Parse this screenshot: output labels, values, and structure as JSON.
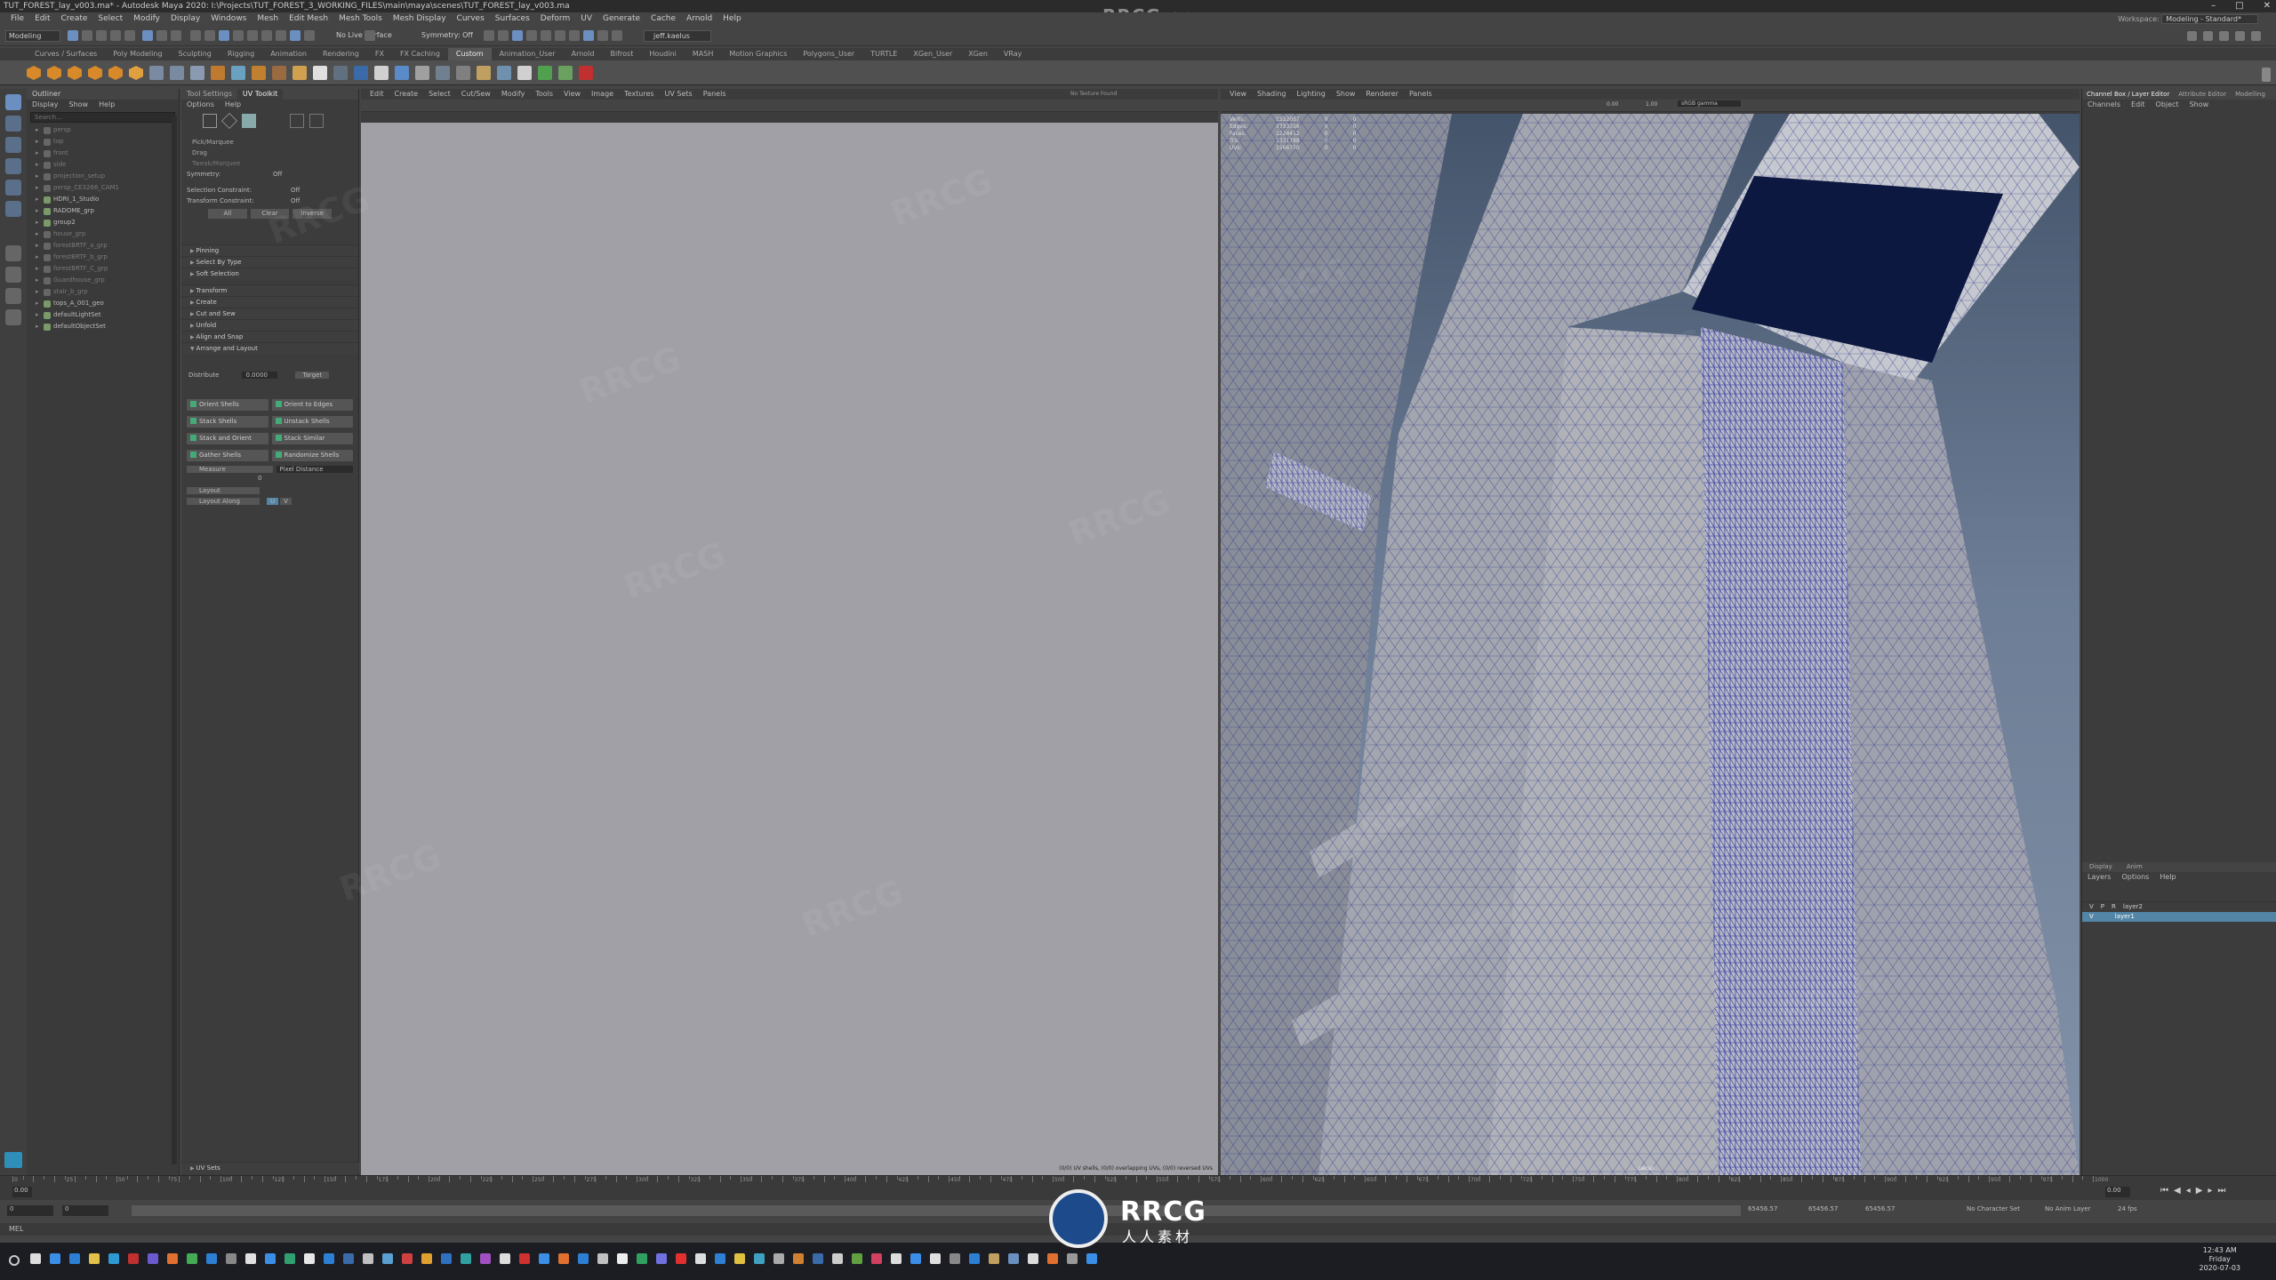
{
  "title_bar": {
    "title": "TUT_FOREST_lay_v003.ma* - Autodesk Maya 2020: I:\\Projects\\TUT_FOREST_3_WORKING_FILES\\main\\maya\\scenes\\TUT_FOREST_lay_v003.ma",
    "minimize": "–",
    "maximize": "□",
    "close": "✕"
  },
  "menu_bar": [
    "File",
    "Edit",
    "Create",
    "Select",
    "Modify",
    "Display",
    "Windows",
    "Mesh",
    "Edit Mesh",
    "Mesh Tools",
    "Mesh Display",
    "Curves",
    "Surfaces",
    "Deform",
    "UV",
    "Generate",
    "Cache",
    "Arnold",
    "Help"
  ],
  "workspace": {
    "label": "Workspace:",
    "value": "Modeling - Standard*"
  },
  "status_line": {
    "mode": "Modeling",
    "live_surface": "No Live Surface",
    "symmetry": "Symmetry: Off",
    "user": "jeff.kaelus"
  },
  "shelf_tabs": [
    "Curves / Surfaces",
    "Poly Modeling",
    "Sculpting",
    "Rigging",
    "Animation",
    "Rendering",
    "FX",
    "FX Caching",
    "Custom",
    "Animation_User",
    "Arnold",
    "Bifrost",
    "Houdini",
    "MASH",
    "Motion Graphics",
    "Polygons_User",
    "TURTLE",
    "XGen_User",
    "XGen",
    "VRay"
  ],
  "shelf_active": "Custom",
  "outliner": {
    "title": "Outliner",
    "menus": [
      "Display",
      "Show",
      "Help"
    ],
    "search_placeholder": "Search...",
    "items": [
      {
        "label": "persp",
        "dim": true
      },
      {
        "label": "top",
        "dim": true
      },
      {
        "label": "front",
        "dim": true
      },
      {
        "label": "side",
        "dim": true
      },
      {
        "label": "projection_setup",
        "dim": true
      },
      {
        "label": "persp_CE3266_CAM1",
        "dim": true
      },
      {
        "label": "HDRI_1_Studio",
        "dim": false
      },
      {
        "label": "RADOME_grp",
        "dim": false
      },
      {
        "label": "group2",
        "dim": false
      },
      {
        "label": "house_grp",
        "dim": true
      },
      {
        "label": "forestBRTF_a_grp",
        "dim": true
      },
      {
        "label": "forestBRTF_b_grp",
        "dim": true
      },
      {
        "label": "forestBRTF_C_grp",
        "dim": true
      },
      {
        "label": "Guardhouse_grp",
        "dim": true
      },
      {
        "label": "stair_b_grp",
        "dim": true
      },
      {
        "label": "tops_A_001_geo",
        "dim": false
      },
      {
        "label": "defaultLightSet",
        "dim": false
      },
      {
        "label": "defaultObjectSet",
        "dim": false
      }
    ]
  },
  "uv_toolkit": {
    "tabs": [
      "Tool Settings",
      "UV Toolkit"
    ],
    "menus": [
      "Options",
      "Help"
    ],
    "pick_marquee": "Pick/Marquee",
    "drag": "Drag",
    "tweak_marquee": "Tweak/Marquee",
    "symmetry_label": "Symmetry:",
    "symmetry_value": "Off",
    "sel_constraint_label": "Selection Constraint:",
    "sel_constraint_value": "Off",
    "xform_constraint_label": "Transform Constraint:",
    "xform_constraint_value": "Off",
    "all": "All",
    "clear": "Clear",
    "inverse": "Inverse",
    "sections_top": [
      "Pinning",
      "Select By Type",
      "Soft Selection"
    ],
    "sections_mid": [
      "Transform",
      "Create",
      "Cut and Sew",
      "Unfold",
      "Align and Snap"
    ],
    "arrange_label": "Arrange and Layout",
    "distribute_label": "Distribute",
    "distribute_value": "0.0000",
    "target": "Target",
    "grid_buttons": [
      [
        "Orient Shells",
        "Orient to Edges"
      ],
      [
        "Stack Shells",
        "Unstack Shells"
      ],
      [
        "Stack and Orient",
        "Stack Similar"
      ],
      [
        "Gather Shells",
        "Randomize Shells"
      ]
    ],
    "measure": "Measure",
    "measure_value": "Pixel Distance",
    "measure_num": "0",
    "layout": "Layout",
    "layout_along": "Layout Along",
    "layout_u": "U",
    "layout_v": "V",
    "uv_sets": "UV Sets"
  },
  "uv_editor": {
    "menus": [
      "Edit",
      "Create",
      "Select",
      "Cut/Sew",
      "Modify",
      "Tools",
      "View",
      "Image",
      "Textures",
      "UV Sets",
      "Panels"
    ],
    "texture": "No Texture Found",
    "info": "(0/0) UV shells, (0/0) overlapping UVs, (0/0) reversed UVs"
  },
  "viewport": {
    "menus": [
      "View",
      "Shading",
      "Lighting",
      "Show",
      "Renderer",
      "Panels"
    ],
    "exposure": "0.00",
    "gamma": "1.00",
    "colorspace": "sRGB gamma",
    "hud": [
      {
        "label": "Verts:",
        "a": "1532057",
        "b": "0",
        "c": "0"
      },
      {
        "label": "Edges:",
        "a": "3733316",
        "b": "0",
        "c": "0"
      },
      {
        "label": "Faces:",
        "a": "1224412",
        "b": "0",
        "c": "0"
      },
      {
        "label": "Tris:",
        "a": "1331788",
        "b": "0",
        "c": "0"
      },
      {
        "label": "UVs:",
        "a": "1566750",
        "b": "0",
        "c": "0"
      }
    ],
    "camera": "persp"
  },
  "channel_box": {
    "tabs": [
      "Channel Box / Layer Editor",
      "Attribute Editor",
      "Modelling"
    ],
    "menus": [
      "Channels",
      "Edit",
      "Object",
      "Show"
    ],
    "layer_tabs": [
      "Display",
      "Anim"
    ],
    "layer_menus": [
      "Layers",
      "Options",
      "Help"
    ],
    "layers": [
      {
        "v": "V",
        "p": "P",
        "r": "R",
        "name": "layer2",
        "selected": false
      },
      {
        "v": "V",
        "p": "",
        "r": "",
        "name": "layer1",
        "selected": true
      }
    ]
  },
  "timeline": {
    "ticks": [
      "0",
      "5",
      "10",
      "15",
      "20",
      "25",
      "30",
      "35",
      "40",
      "45",
      "50",
      "55",
      "60",
      "65",
      "70",
      "75",
      "80",
      "85",
      "90",
      "95",
      "100",
      "105",
      "110",
      "115",
      "120",
      "125",
      "130",
      "135",
      "140",
      "145",
      "150",
      "155",
      "160",
      "165",
      "170",
      "175",
      "180",
      "185",
      "190",
      "195",
      "200",
      "205",
      "210",
      "215",
      "220",
      "225",
      "230",
      "235",
      "240",
      "245",
      "250",
      "255",
      "260",
      "265",
      "270",
      "275",
      "280",
      "285",
      "290",
      "295",
      "300",
      "305",
      "310",
      "315",
      "320",
      "325",
      "330",
      "335",
      "340",
      "345",
      "350",
      "355",
      "360",
      "365",
      "370",
      "375",
      "380",
      "385",
      "390",
      "395",
      "400",
      "405",
      "410",
      "415",
      "420",
      "425",
      "430",
      "435",
      "440",
      "445",
      "450",
      "455",
      "460",
      "465",
      "470",
      "475",
      "480",
      "485",
      "490",
      "495",
      "500",
      "505",
      "510",
      "515",
      "520",
      "525",
      "530",
      "535",
      "540",
      "545",
      "550",
      "555",
      "560",
      "565",
      "570",
      "575",
      "580",
      "585",
      "590",
      "595",
      "600",
      "605",
      "610",
      "615",
      "620",
      "625",
      "630",
      "635",
      "640",
      "645",
      "650",
      "655",
      "660",
      "665",
      "670",
      "675",
      "680",
      "685",
      "690",
      "695",
      "700",
      "705",
      "710",
      "715",
      "720",
      "725",
      "730",
      "735",
      "740",
      "745",
      "750",
      "755",
      "760",
      "765",
      "770",
      "775",
      "780",
      "785",
      "790",
      "795",
      "800",
      "805",
      "810",
      "815",
      "820",
      "825",
      "830",
      "835",
      "840",
      "845",
      "850",
      "855",
      "860",
      "865",
      "870",
      "875",
      "880",
      "885",
      "890",
      "895",
      "900",
      "905",
      "910",
      "915",
      "920",
      "925",
      "930",
      "935",
      "940",
      "945",
      "950",
      "955",
      "960",
      "965",
      "970",
      "975",
      "980",
      "985",
      "990",
      "995",
      "1000"
    ],
    "current": "0.00",
    "right_field": "0.00",
    "start": "0",
    "end": "0",
    "range_a": "65456.57",
    "range_b": "65456.57",
    "range_c": "65456.57",
    "char_set": "No Character Set",
    "anim_layer": "No Anim Layer",
    "fps": "24 fps"
  },
  "cmd": {
    "label": "MEL"
  },
  "clock": {
    "time": "12:43 AM",
    "day": "Friday",
    "date": "2020-07-03"
  },
  "watermark": {
    "top": "RRCG.cn",
    "logo_text": "RRCG",
    "logo_sub": "人人素材",
    "tile": "RRCG"
  }
}
